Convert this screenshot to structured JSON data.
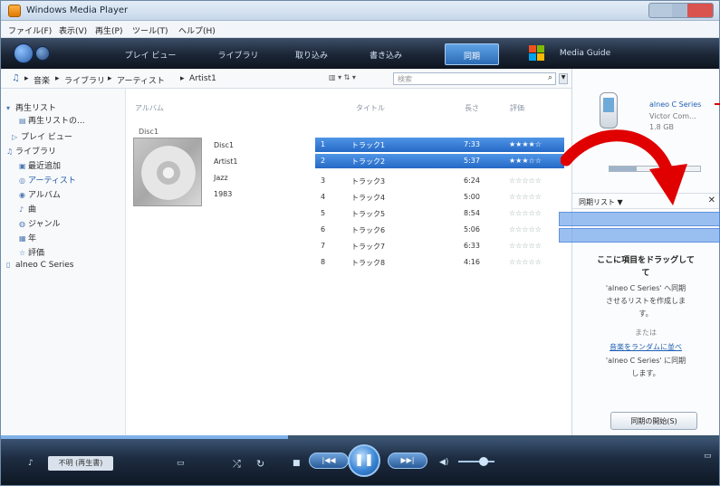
{
  "window": {
    "title": "Windows Media Player"
  },
  "menu": [
    "ファイル(F)",
    "表示(V)",
    "再生(P)",
    "ツール(T)",
    "ヘルプ(H)"
  ],
  "nav_tabs": [
    {
      "label": "プレイ ビュー",
      "active": false
    },
    {
      "label": "ライブラリ",
      "active": false
    },
    {
      "label": "取り込み",
      "active": false
    },
    {
      "label": "書き込み",
      "active": false
    },
    {
      "label": "同期",
      "active": true
    },
    {
      "label": "Media Guide",
      "active": false
    }
  ],
  "breadcrumb": [
    "音楽",
    "ライブラリ",
    "アーティスト",
    "Artist1"
  ],
  "search": {
    "placeholder": "検索"
  },
  "tree": [
    {
      "label": "再生リスト",
      "icon": "playlist-icon"
    },
    {
      "label": "再生リストの...",
      "icon": "playlist-create-icon"
    },
    {
      "label": "プレイ ビュー",
      "icon": "now-playing-icon"
    },
    {
      "label": "ライブラリ",
      "icon": "library-icon"
    },
    {
      "label": "最近追加",
      "icon": "recent-icon"
    },
    {
      "label": "アーティスト",
      "icon": "artist-icon",
      "selected": true
    },
    {
      "label": "アルバム",
      "icon": "album-icon"
    },
    {
      "label": "曲",
      "icon": "song-icon"
    },
    {
      "label": "ジャンル",
      "icon": "genre-icon"
    },
    {
      "label": "年",
      "icon": "year-icon"
    },
    {
      "label": "評価",
      "icon": "rating-icon"
    },
    {
      "label": "alneo C Series",
      "icon": "device-icon"
    }
  ],
  "columns": {
    "album": "アルバム",
    "title": "タイトル",
    "length": "長さ",
    "rating": "評価"
  },
  "album": {
    "group": "Disc1",
    "name": "Disc1",
    "artist": "Artist1",
    "genre": "Jazz",
    "year": "1983"
  },
  "tracks": [
    {
      "no": "1",
      "title": "トラック1",
      "length": "7:33",
      "rating": "★★★★☆",
      "selected": true
    },
    {
      "no": "2",
      "title": "トラック2",
      "length": "5:37",
      "rating": "★★★☆☆",
      "selected": true
    },
    {
      "no": "3",
      "title": "トラック3",
      "length": "6:24",
      "rating": "☆☆☆☆☆",
      "selected": false
    },
    {
      "no": "4",
      "title": "トラック4",
      "length": "5:00",
      "rating": "☆☆☆☆☆",
      "selected": false
    },
    {
      "no": "5",
      "title": "トラック5",
      "length": "8:54",
      "rating": "☆☆☆☆☆",
      "selected": false
    },
    {
      "no": "6",
      "title": "トラック6",
      "length": "5:06",
      "rating": "☆☆☆☆☆",
      "selected": false
    },
    {
      "no": "7",
      "title": "トラック7",
      "length": "6:33",
      "rating": "☆☆☆☆☆",
      "selected": false
    },
    {
      "no": "8",
      "title": "トラック8",
      "length": "4:16",
      "rating": "☆☆☆☆☆",
      "selected": false
    }
  ],
  "device": {
    "name": "alneo C Series",
    "maker": "Victor Com...",
    "capacity": "1.8 GB"
  },
  "sync_pane": {
    "title": "同期リスト ▼",
    "close": "✕",
    "drop_msg": "ここに項目をドラッグして",
    "drop_msg_end": "て",
    "desc_1": "'alneo C Series' へ同期",
    "desc_2": "させるリストを作成しま",
    "desc_3": "す。",
    "or": "または",
    "shuffle_link": "音楽をランダムに並べ",
    "link_desc_1": "'alneo C Series' に同期",
    "link_desc_2": "します。",
    "start_button": "同期の開始(S)"
  },
  "player": {
    "status": "不明 (再生書)",
    "shuffle": "⤮",
    "repeat": "↻",
    "stop": "■",
    "prev": "|◀◀",
    "play": "❚❚",
    "next": "▶▶|",
    "volume": "◀)"
  },
  "colors": {
    "accent": "#2569c6",
    "navbar": "#1b2535",
    "arrow": "#e00000"
  }
}
